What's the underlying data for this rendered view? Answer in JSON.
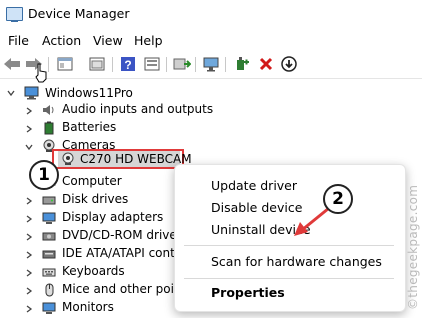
{
  "window": {
    "title": "Device Manager"
  },
  "menu": [
    "File",
    "Action",
    "View",
    "Help"
  ],
  "toolbar": {
    "buttons": [
      "back-arrow-icon",
      "forward-arrow-icon",
      "properties-icon",
      "show-hide-tree-icon",
      "help-icon",
      "view-icon",
      "update-driver-icon",
      "scan-hardware-icon",
      "add-driver-icon",
      "uninstall-icon",
      "download-driver-icon"
    ]
  },
  "tree": {
    "root": "Windows11Pro",
    "categories": [
      "Audio inputs and outputs",
      "Batteries",
      "Cameras",
      "Computer",
      "Disk drives",
      "Display adapters",
      "DVD/CD-ROM drives",
      "IDE ATA/ATAPI contro",
      "Keyboards",
      "Mice and other pointi",
      "Monitors"
    ],
    "selected_device": "C270 HD WEBCAM"
  },
  "context_menu": {
    "items": [
      "Update driver",
      "Disable device",
      "Uninstall device",
      "Scan for hardware changes",
      "Properties"
    ]
  },
  "annotations": {
    "step1": "1",
    "step2": "2"
  },
  "watermark": "©thegeekpage.com",
  "colors": {
    "highlight_border": "#e03a3a",
    "arrow": "#e03a3a",
    "selection_bg": "#d6d6d6"
  }
}
